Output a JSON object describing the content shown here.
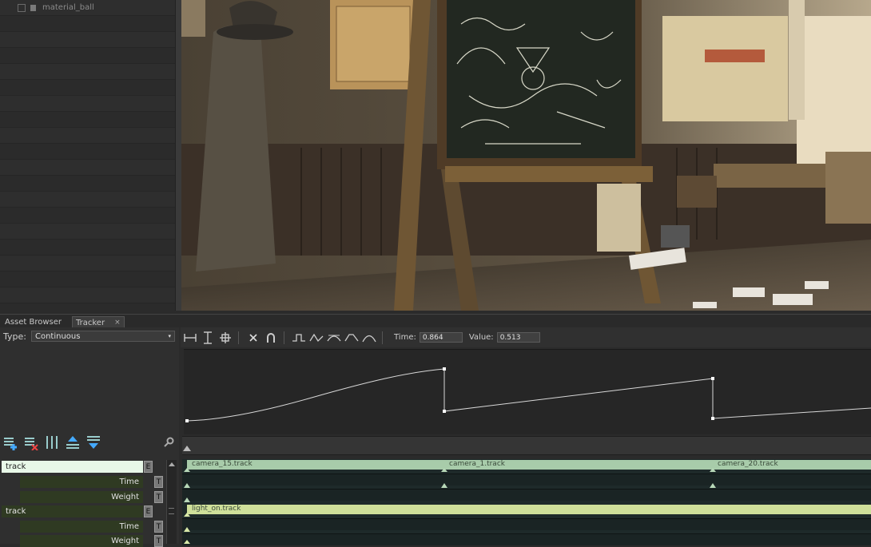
{
  "outliner": {
    "first_item": "material_ball"
  },
  "tabs": [
    {
      "label": "Asset Browser",
      "close": "×"
    },
    {
      "label": "Tracker",
      "close": "×"
    }
  ],
  "tracker": {
    "type_label": "Type:",
    "type_value": "Continuous",
    "time_label": "Time:",
    "time_value": "0.864",
    "value_label": "Value:",
    "value_value": "0.513"
  },
  "icons": {
    "graph_toolbar": [
      "fit-horizontal-icon",
      "fit-vertical-icon",
      "fit-all-icon",
      "delete-key-icon",
      "magnet-icon",
      "step-tangent-icon",
      "linear-tangent-icon",
      "smooth-tangent-icon",
      "flat-tangent-icon",
      "ease-tangent-icon"
    ],
    "left_tools": [
      "add-track-icon",
      "remove-track-icon",
      "columns-icon",
      "move-up-icon",
      "move-down-icon",
      "wrench-icon"
    ]
  },
  "tracks": [
    {
      "name": "track",
      "e_button": "E",
      "clip_color": "#a8ccaa",
      "clips": [
        "camera_15.track",
        "camera_1.track",
        "camera_20.track"
      ],
      "params": [
        {
          "label": "Time",
          "t_button": "T"
        },
        {
          "label": "Weight",
          "t_button": "T"
        }
      ]
    },
    {
      "name": "track",
      "e_button": "E",
      "clip_color": "#cfe09a",
      "clips": [
        "light_on.track"
      ],
      "params": [
        {
          "label": "Time",
          "t_button": "T"
        },
        {
          "label": "Weight",
          "t_button": "T"
        }
      ]
    }
  ],
  "colors": {
    "curve": "#d8d8d8",
    "track1_header_bg": "#e8f8e8",
    "track2_header_bg": "#2f3a22"
  }
}
